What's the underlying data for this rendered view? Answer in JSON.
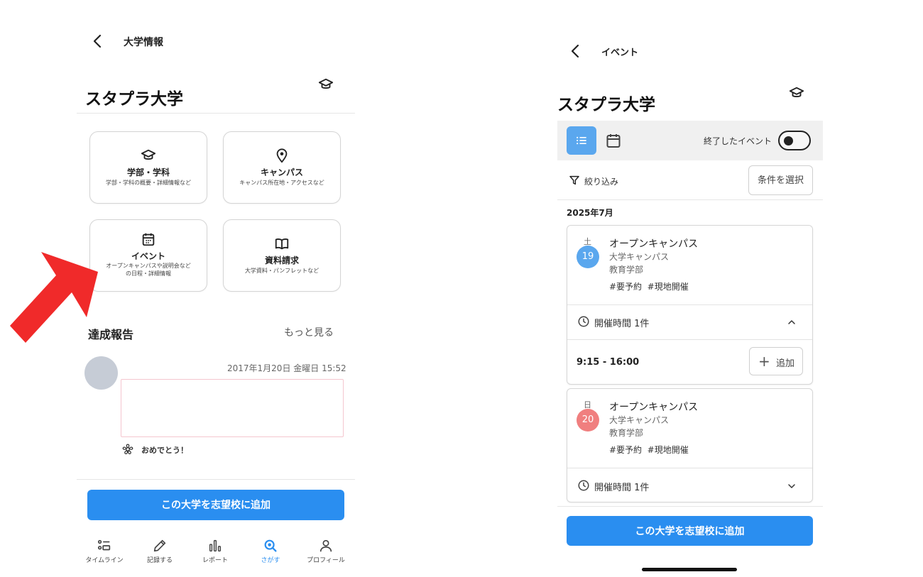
{
  "left": {
    "header_title": "大学情報",
    "university_name": "スタプラ大学",
    "cards": [
      {
        "title": "学部・学科",
        "subtitle": "学部・学科の概要・詳細情報など",
        "icon": "graduation-cap-icon"
      },
      {
        "title": "キャンパス",
        "subtitle": "キャンパス所在地・アクセスなど",
        "icon": "location-pin-icon"
      },
      {
        "title": "イベント",
        "subtitle_line1": "オープンキャンパスや説明会など",
        "subtitle_line2": "の日程・詳細情報",
        "icon": "calendar-icon"
      },
      {
        "title": "資料請求",
        "subtitle": "大学資料・パンフレットなど",
        "icon": "open-book-icon"
      }
    ],
    "reports": {
      "section_title": "達成報告",
      "more_label": "もっと見る",
      "timestamp": "2017年1月20日 金曜日 15:52",
      "congrats_label": "おめでとう！"
    },
    "add_button_label": "この大学を志望校に追加",
    "tabs": [
      {
        "label": "タイムライン",
        "icon": "timeline-icon"
      },
      {
        "label": "記録する",
        "icon": "pencil-icon"
      },
      {
        "label": "レポート",
        "icon": "bar-chart-icon"
      },
      {
        "label": "さがす",
        "icon": "search-icon",
        "active": true
      },
      {
        "label": "プロフィール",
        "icon": "person-icon"
      }
    ],
    "accent_color": "#2a8ef0",
    "arrow_color": "#f02a2a"
  },
  "right": {
    "header_title": "イベント",
    "university_name": "スタプラ大学",
    "ended_events_label": "終了したイベント",
    "filter_label": "絞り込み",
    "select_conditions_label": "条件を選択",
    "month_label": "2025年7月",
    "events": [
      {
        "day_of_week": "土",
        "day": "19",
        "badge_color": "#5aa7ee",
        "title": "オープンキャンパス",
        "campus": "大学キャンパス",
        "faculty": "教育学部",
        "tags": "#要予約  #現地開催",
        "hours_label": "開催時間 1件",
        "expanded": true,
        "time_range": "9:15 - 16:00",
        "add_label": "追加"
      },
      {
        "day_of_week": "日",
        "day": "20",
        "badge_color": "#f07f7f",
        "title": "オープンキャンパス",
        "campus": "大学キャンパス",
        "faculty": "教育学部",
        "tags": "#要予約  #現地開催",
        "hours_label": "開催時間 1件",
        "expanded": false
      }
    ],
    "add_button_label": "この大学を志望校に追加"
  }
}
